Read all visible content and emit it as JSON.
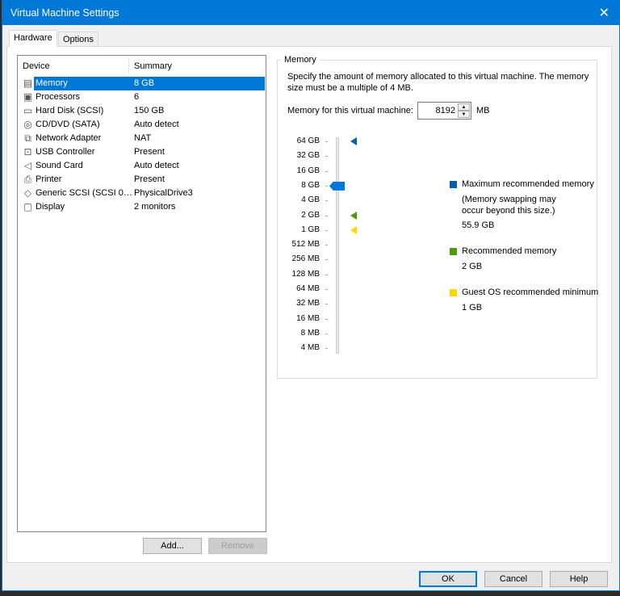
{
  "window": {
    "title": "Virtual Machine Settings"
  },
  "tabs": [
    {
      "label": "Hardware"
    },
    {
      "label": "Options"
    }
  ],
  "devices": {
    "headers": {
      "device": "Device",
      "summary": "Summary"
    },
    "rows": [
      {
        "icon": "memory-icon",
        "glyph": "▤",
        "name": "Memory",
        "summary": "8 GB"
      },
      {
        "icon": "processor-icon",
        "glyph": "▣",
        "name": "Processors",
        "summary": "6"
      },
      {
        "icon": "hard-disk-icon",
        "glyph": "▭",
        "name": "Hard Disk (SCSI)",
        "summary": "150 GB"
      },
      {
        "icon": "cd-dvd-icon",
        "glyph": "◎",
        "name": "CD/DVD (SATA)",
        "summary": "Auto detect"
      },
      {
        "icon": "network-adapter-icon",
        "glyph": "⧉",
        "name": "Network Adapter",
        "summary": "NAT"
      },
      {
        "icon": "usb-icon",
        "glyph": "⊡",
        "name": "USB Controller",
        "summary": "Present"
      },
      {
        "icon": "speaker-icon",
        "glyph": "◁",
        "name": "Sound Card",
        "summary": "Auto detect"
      },
      {
        "icon": "printer-icon",
        "glyph": "⎙",
        "name": "Printer",
        "summary": "Present"
      },
      {
        "icon": "scsi-icon",
        "glyph": "◇",
        "name": "Generic SCSI (SCSI 0…",
        "summary": "PhysicalDrive3"
      },
      {
        "icon": "display-icon",
        "glyph": "▢",
        "name": "Display",
        "summary": "2 monitors"
      }
    ],
    "add_label": "Add...",
    "remove_label": "Remove"
  },
  "memory": {
    "group_label": "Memory",
    "description": "Specify the amount of memory allocated to this virtual machine. The memory size must be a multiple of 4 MB.",
    "field_label": "Memory for this virtual machine:",
    "value": "8192",
    "unit": "MB",
    "ticks": [
      "64 GB",
      "32 GB",
      "16 GB",
      "8 GB",
      "4 GB",
      "2 GB",
      "1 GB",
      "512 MB",
      "256 MB",
      "128 MB",
      "64 MB",
      "32 MB",
      "16 MB",
      "8 MB",
      "4 MB"
    ],
    "slider_index": 3,
    "legend": {
      "max_label": "Maximum recommended memory",
      "max_note": "(Memory swapping may occur beyond this size.)",
      "max_value": "55.9 GB",
      "rec_label": "Recommended memory",
      "rec_value": "2 GB",
      "min_label": "Guest OS recommended minimum",
      "min_value": "1 GB"
    },
    "markers": [
      {
        "index": 0,
        "color": "#005fb3"
      },
      {
        "index": 5,
        "color": "#4e9a06"
      },
      {
        "index": 6,
        "color": "#ffd800"
      }
    ]
  },
  "footer": {
    "ok": "OK",
    "cancel": "Cancel",
    "help": "Help"
  }
}
